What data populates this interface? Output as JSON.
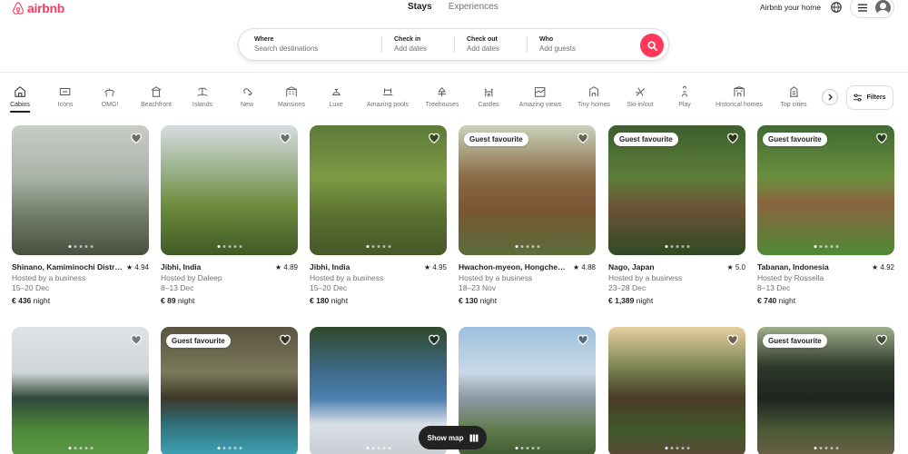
{
  "header": {
    "logo_text": "airbnb",
    "tabs": [
      {
        "label": "Stays"
      },
      {
        "label": "Experiences"
      }
    ],
    "host_link": "Airbnb your home"
  },
  "search": {
    "where_label": "Where",
    "where_placeholder": "Search destinations",
    "checkin_label": "Check in",
    "checkin_placeholder": "Add dates",
    "checkout_label": "Check out",
    "checkout_placeholder": "Add dates",
    "who_label": "Who",
    "who_placeholder": "Add guests"
  },
  "categories": [
    {
      "label": "Cabins",
      "icon": "cabin-icon",
      "active": true
    },
    {
      "label": "Icons",
      "icon": "icons-icon"
    },
    {
      "label": "OMG!",
      "icon": "ufo-house-icon"
    },
    {
      "label": "Beachfront",
      "icon": "beach-icon"
    },
    {
      "label": "Islands",
      "icon": "island-icon"
    },
    {
      "label": "New",
      "icon": "key-icon"
    },
    {
      "label": "Mansions",
      "icon": "mansion-icon"
    },
    {
      "label": "Luxe",
      "icon": "luxe-icon"
    },
    {
      "label": "Amazing pools",
      "icon": "pool-icon"
    },
    {
      "label": "Treehouses",
      "icon": "treehouse-icon"
    },
    {
      "label": "Castles",
      "icon": "castle-icon"
    },
    {
      "label": "Amazing views",
      "icon": "view-icon"
    },
    {
      "label": "Tiny homes",
      "icon": "tiny-home-icon"
    },
    {
      "label": "Ski-in/out",
      "icon": "ski-icon"
    },
    {
      "label": "Play",
      "icon": "bowling-icon"
    },
    {
      "label": "Historical homes",
      "icon": "historical-home-icon"
    },
    {
      "label": "Top cities",
      "icon": "city-icon"
    }
  ],
  "filters_label": "Filters",
  "listings": [
    {
      "location": "Shinano, Kamiminochi Distric…",
      "rating": "4.94",
      "host": "Hosted by a business",
      "dates": "15–20 Dec",
      "price": "€ 436",
      "unit": "night",
      "badge": ""
    },
    {
      "location": "Jibhi, India",
      "rating": "4.89",
      "host": "Hosted by Daleep",
      "dates": "8–13 Dec",
      "price": "€ 89",
      "unit": "night",
      "badge": ""
    },
    {
      "location": "Jibhi, India",
      "rating": "4.95",
      "host": "Hosted by a business",
      "dates": "15–20 Dec",
      "price": "€ 180",
      "unit": "night",
      "badge": ""
    },
    {
      "location": "Hwachon-myeon, Hongcheo…",
      "rating": "4.88",
      "host": "Hosted by a business",
      "dates": "18–23 Nov",
      "price": "€ 130",
      "unit": "night",
      "badge": "Guest favourite"
    },
    {
      "location": "Nago, Japan",
      "rating": "5.0",
      "host": "Hosted by a business",
      "dates": "23–28 Dec",
      "price": "€ 1,389",
      "unit": "night",
      "badge": "Guest favourite"
    },
    {
      "location": "Tabanan, Indonesia",
      "rating": "4.92",
      "host": "Hosted by Rossella",
      "dates": "8–13 Dec",
      "price": "€ 740",
      "unit": "night",
      "badge": "Guest favourite"
    },
    {
      "badge": ""
    },
    {
      "badge": "Guest favourite"
    },
    {
      "badge": ""
    },
    {
      "badge": ""
    },
    {
      "badge": ""
    },
    {
      "badge": "Guest favourite"
    }
  ],
  "show_map_label": "Show map",
  "colors": {
    "brand": "#FF385C",
    "text": "#222222",
    "muted": "#717171"
  }
}
